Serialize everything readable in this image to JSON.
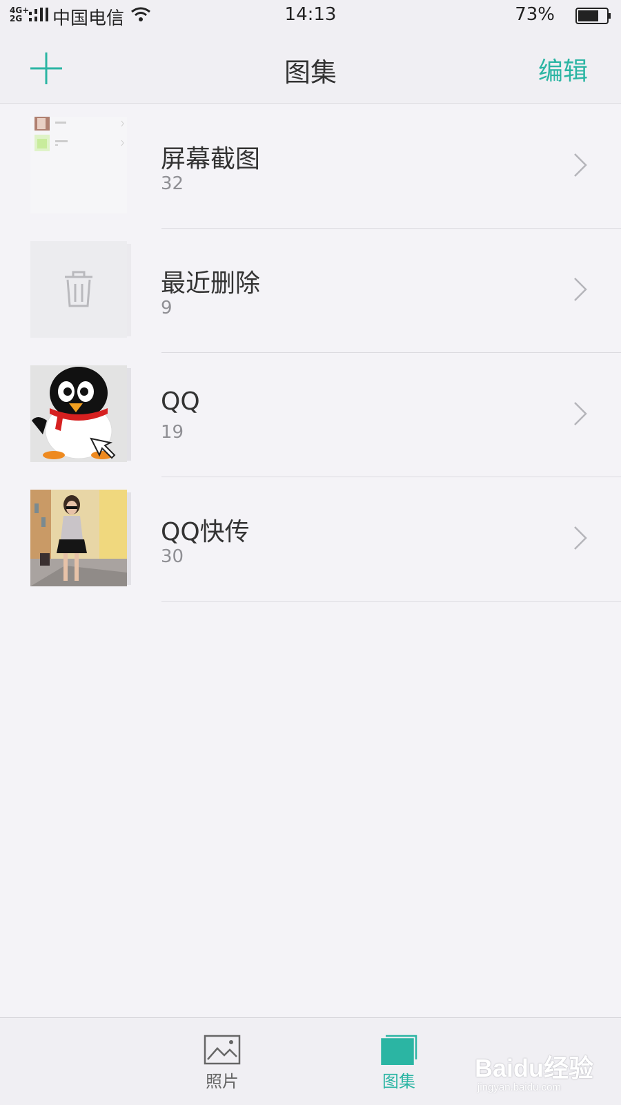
{
  "status_bar": {
    "network_top": "4G+",
    "network_bottom": "2G",
    "carrier": "中国电信",
    "time": "14:13",
    "battery_percent": "73%",
    "battery_level": 0.73
  },
  "nav": {
    "title": "图集",
    "edit_label": "编辑",
    "add_icon": "plus-icon"
  },
  "albums": [
    {
      "name": "屏幕截图",
      "count": "32",
      "thumb": "screenshot-thumbnail"
    },
    {
      "name": "最近删除",
      "count": "9",
      "thumb": "trash-icon"
    },
    {
      "name": "QQ",
      "count": "19",
      "thumb": "qq-penguin-thumbnail"
    },
    {
      "name": "QQ快传",
      "count": "30",
      "thumb": "photo-thumbnail"
    }
  ],
  "tabs": [
    {
      "label": "照片",
      "icon": "photo-icon",
      "active": false
    },
    {
      "label": "图集",
      "icon": "albums-icon",
      "active": true
    }
  ],
  "watermark": {
    "brand": "Baidu经验",
    "url": "jingyan.baidu.com"
  },
  "colors": {
    "accent": "#2bb5a3",
    "background": "#f4f3f7",
    "bar": "#f0eff3"
  }
}
